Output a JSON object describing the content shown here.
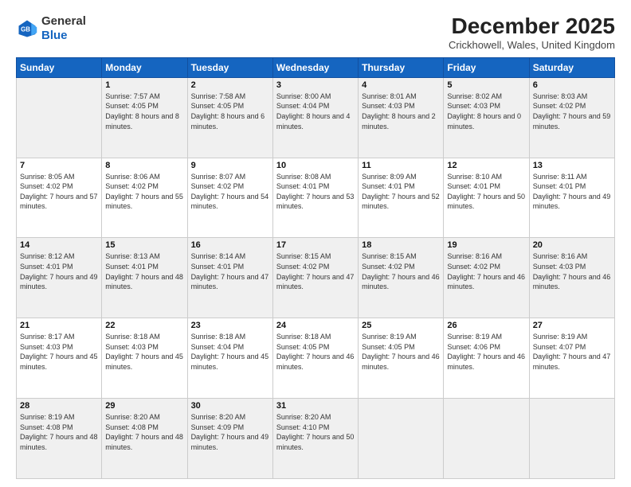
{
  "logo": {
    "line1": "General",
    "line2": "Blue"
  },
  "title": "December 2025",
  "subtitle": "Crickhowell, Wales, United Kingdom",
  "weekdays": [
    "Sunday",
    "Monday",
    "Tuesday",
    "Wednesday",
    "Thursday",
    "Friday",
    "Saturday"
  ],
  "weeks": [
    [
      {
        "day": "",
        "sunrise": "",
        "sunset": "",
        "daylight": ""
      },
      {
        "day": "1",
        "sunrise": "Sunrise: 7:57 AM",
        "sunset": "Sunset: 4:05 PM",
        "daylight": "Daylight: 8 hours and 8 minutes."
      },
      {
        "day": "2",
        "sunrise": "Sunrise: 7:58 AM",
        "sunset": "Sunset: 4:05 PM",
        "daylight": "Daylight: 8 hours and 6 minutes."
      },
      {
        "day": "3",
        "sunrise": "Sunrise: 8:00 AM",
        "sunset": "Sunset: 4:04 PM",
        "daylight": "Daylight: 8 hours and 4 minutes."
      },
      {
        "day": "4",
        "sunrise": "Sunrise: 8:01 AM",
        "sunset": "Sunset: 4:03 PM",
        "daylight": "Daylight: 8 hours and 2 minutes."
      },
      {
        "day": "5",
        "sunrise": "Sunrise: 8:02 AM",
        "sunset": "Sunset: 4:03 PM",
        "daylight": "Daylight: 8 hours and 0 minutes."
      },
      {
        "day": "6",
        "sunrise": "Sunrise: 8:03 AM",
        "sunset": "Sunset: 4:02 PM",
        "daylight": "Daylight: 7 hours and 59 minutes."
      }
    ],
    [
      {
        "day": "7",
        "sunrise": "Sunrise: 8:05 AM",
        "sunset": "Sunset: 4:02 PM",
        "daylight": "Daylight: 7 hours and 57 minutes."
      },
      {
        "day": "8",
        "sunrise": "Sunrise: 8:06 AM",
        "sunset": "Sunset: 4:02 PM",
        "daylight": "Daylight: 7 hours and 55 minutes."
      },
      {
        "day": "9",
        "sunrise": "Sunrise: 8:07 AM",
        "sunset": "Sunset: 4:02 PM",
        "daylight": "Daylight: 7 hours and 54 minutes."
      },
      {
        "day": "10",
        "sunrise": "Sunrise: 8:08 AM",
        "sunset": "Sunset: 4:01 PM",
        "daylight": "Daylight: 7 hours and 53 minutes."
      },
      {
        "day": "11",
        "sunrise": "Sunrise: 8:09 AM",
        "sunset": "Sunset: 4:01 PM",
        "daylight": "Daylight: 7 hours and 52 minutes."
      },
      {
        "day": "12",
        "sunrise": "Sunrise: 8:10 AM",
        "sunset": "Sunset: 4:01 PM",
        "daylight": "Daylight: 7 hours and 50 minutes."
      },
      {
        "day": "13",
        "sunrise": "Sunrise: 8:11 AM",
        "sunset": "Sunset: 4:01 PM",
        "daylight": "Daylight: 7 hours and 49 minutes."
      }
    ],
    [
      {
        "day": "14",
        "sunrise": "Sunrise: 8:12 AM",
        "sunset": "Sunset: 4:01 PM",
        "daylight": "Daylight: 7 hours and 49 minutes."
      },
      {
        "day": "15",
        "sunrise": "Sunrise: 8:13 AM",
        "sunset": "Sunset: 4:01 PM",
        "daylight": "Daylight: 7 hours and 48 minutes."
      },
      {
        "day": "16",
        "sunrise": "Sunrise: 8:14 AM",
        "sunset": "Sunset: 4:01 PM",
        "daylight": "Daylight: 7 hours and 47 minutes."
      },
      {
        "day": "17",
        "sunrise": "Sunrise: 8:15 AM",
        "sunset": "Sunset: 4:02 PM",
        "daylight": "Daylight: 7 hours and 47 minutes."
      },
      {
        "day": "18",
        "sunrise": "Sunrise: 8:15 AM",
        "sunset": "Sunset: 4:02 PM",
        "daylight": "Daylight: 7 hours and 46 minutes."
      },
      {
        "day": "19",
        "sunrise": "Sunrise: 8:16 AM",
        "sunset": "Sunset: 4:02 PM",
        "daylight": "Daylight: 7 hours and 46 minutes."
      },
      {
        "day": "20",
        "sunrise": "Sunrise: 8:16 AM",
        "sunset": "Sunset: 4:03 PM",
        "daylight": "Daylight: 7 hours and 46 minutes."
      }
    ],
    [
      {
        "day": "21",
        "sunrise": "Sunrise: 8:17 AM",
        "sunset": "Sunset: 4:03 PM",
        "daylight": "Daylight: 7 hours and 45 minutes."
      },
      {
        "day": "22",
        "sunrise": "Sunrise: 8:18 AM",
        "sunset": "Sunset: 4:03 PM",
        "daylight": "Daylight: 7 hours and 45 minutes."
      },
      {
        "day": "23",
        "sunrise": "Sunrise: 8:18 AM",
        "sunset": "Sunset: 4:04 PM",
        "daylight": "Daylight: 7 hours and 45 minutes."
      },
      {
        "day": "24",
        "sunrise": "Sunrise: 8:18 AM",
        "sunset": "Sunset: 4:05 PM",
        "daylight": "Daylight: 7 hours and 46 minutes."
      },
      {
        "day": "25",
        "sunrise": "Sunrise: 8:19 AM",
        "sunset": "Sunset: 4:05 PM",
        "daylight": "Daylight: 7 hours and 46 minutes."
      },
      {
        "day": "26",
        "sunrise": "Sunrise: 8:19 AM",
        "sunset": "Sunset: 4:06 PM",
        "daylight": "Daylight: 7 hours and 46 minutes."
      },
      {
        "day": "27",
        "sunrise": "Sunrise: 8:19 AM",
        "sunset": "Sunset: 4:07 PM",
        "daylight": "Daylight: 7 hours and 47 minutes."
      }
    ],
    [
      {
        "day": "28",
        "sunrise": "Sunrise: 8:19 AM",
        "sunset": "Sunset: 4:08 PM",
        "daylight": "Daylight: 7 hours and 48 minutes."
      },
      {
        "day": "29",
        "sunrise": "Sunrise: 8:20 AM",
        "sunset": "Sunset: 4:08 PM",
        "daylight": "Daylight: 7 hours and 48 minutes."
      },
      {
        "day": "30",
        "sunrise": "Sunrise: 8:20 AM",
        "sunset": "Sunset: 4:09 PM",
        "daylight": "Daylight: 7 hours and 49 minutes."
      },
      {
        "day": "31",
        "sunrise": "Sunrise: 8:20 AM",
        "sunset": "Sunset: 4:10 PM",
        "daylight": "Daylight: 7 hours and 50 minutes."
      },
      {
        "day": "",
        "sunrise": "",
        "sunset": "",
        "daylight": ""
      },
      {
        "day": "",
        "sunrise": "",
        "sunset": "",
        "daylight": ""
      },
      {
        "day": "",
        "sunrise": "",
        "sunset": "",
        "daylight": ""
      }
    ]
  ]
}
